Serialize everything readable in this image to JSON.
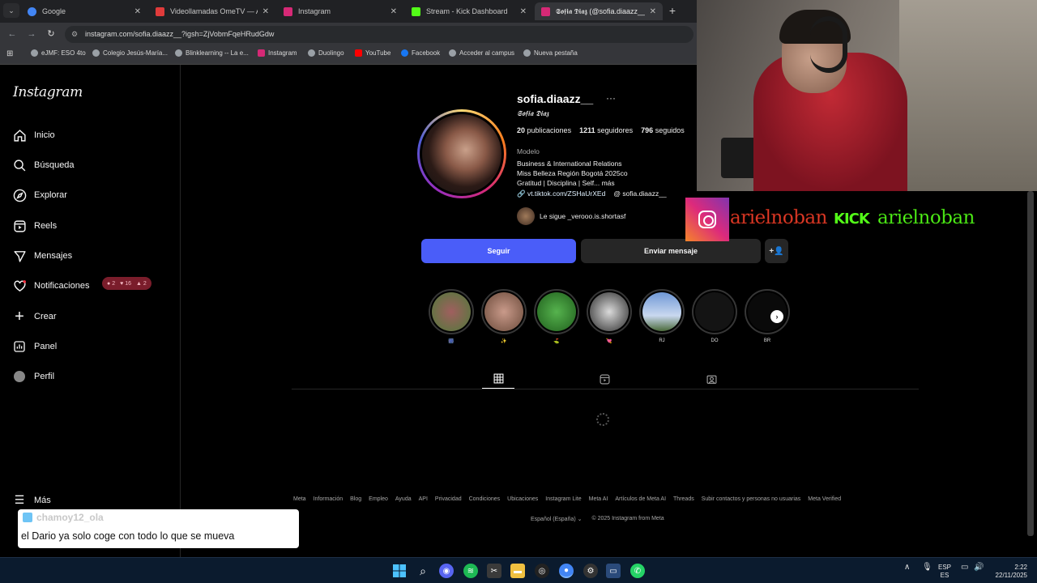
{
  "browser": {
    "tabs": [
      {
        "title": "Google",
        "color": "#4285f4"
      },
      {
        "title": "Videollamadas OmeTV — Alter",
        "color": "#e03b3b"
      },
      {
        "title": "Instagram",
        "color": "#d62976"
      },
      {
        "title": "Stream - Kick Dashboard",
        "color": "#53fc18"
      },
      {
        "title": "𝕾𝖔𝖋𝖎𝖆 𝕯𝖎𝖆𝖟 (@sofia.diaazz__) • I",
        "color": "#d62976",
        "active": true
      }
    ],
    "url": "instagram.com/sofia.diaazz__?igsh=ZjVobmFqeHRudGdw",
    "bookmarks": [
      "eJMF: ESO 4to",
      "Colegio Jesús-María...",
      "Blinklearning -- La e...",
      "Instagram",
      "Duolingo",
      "YouTube",
      "Facebook",
      "Acceder al campus",
      "Nueva pestaña"
    ]
  },
  "sidebar": {
    "logo": "Instagram",
    "items": [
      "Inicio",
      "Búsqueda",
      "Explorar",
      "Reels",
      "Mensajes",
      "Notificaciones",
      "Crear",
      "Panel",
      "Perfil"
    ],
    "more": "Más",
    "notif_badge": {
      "comments": "2",
      "likes": "16",
      "follows": "2"
    }
  },
  "profile": {
    "username": "sofia.diaazz__",
    "full_name": "𝕾𝖔𝖋𝖎𝖆 𝕯𝖎𝖆𝖟",
    "posts": "20",
    "posts_label": "publicaciones",
    "followers": "1211",
    "followers_label": "seguidores",
    "following": "796",
    "following_label": "seguidos",
    "category": "Modelo",
    "bio": [
      "Business & International Relations",
      "Miss Belleza Región Bogotá 2025co",
      "Gratitud | Disciplina | Self... más"
    ],
    "link": "vt.tiktok.com/ZSHaUrXEd",
    "threads": "sofia.diaazz__",
    "followed_by": "Le sigue _verooo.is.shortasf",
    "follow_btn": "Seguir",
    "message_btn": "Enviar mensaje",
    "highlights": [
      {
        "label": "🎆",
        "color": "#5f8a45"
      },
      {
        "label": "✨",
        "color": "#b98a78"
      },
      {
        "label": "⛳",
        "color": "#3f9a3a"
      },
      {
        "label": "💘",
        "color": "#a9a9a9"
      },
      {
        "label": "RJ",
        "color": "#6f8fbf"
      },
      {
        "label": "DO",
        "color": "#111111"
      },
      {
        "label": "BR",
        "color": "#0a0a0a"
      }
    ]
  },
  "footer": {
    "links": [
      "Meta",
      "Información",
      "Blog",
      "Empleo",
      "Ayuda",
      "API",
      "Privacidad",
      "Condiciones",
      "Ubicaciones",
      "Instagram Lite",
      "Meta AI",
      "Artículos de Meta AI",
      "Threads",
      "Subir contactos y personas no usuarias",
      "Meta Verified"
    ],
    "language": "Español (España)",
    "copyright": "© 2025 Instagram from Meta"
  },
  "overlay": {
    "ig_name": "arielnoban",
    "kick_logo": "KICK",
    "kick_name": "arielnoban",
    "chat_user": "chamoy12_ola",
    "chat_message": "el Dario ya solo coge con todo lo que se mueva"
  },
  "taskbar": {
    "lang_top": "ESP",
    "lang_bottom": "ES",
    "time": "2:22",
    "date": "22/11/2025"
  },
  "colors": {
    "follow": "#4a5df9",
    "kick": "#53fc18",
    "ig_red": "#e23c2a"
  }
}
